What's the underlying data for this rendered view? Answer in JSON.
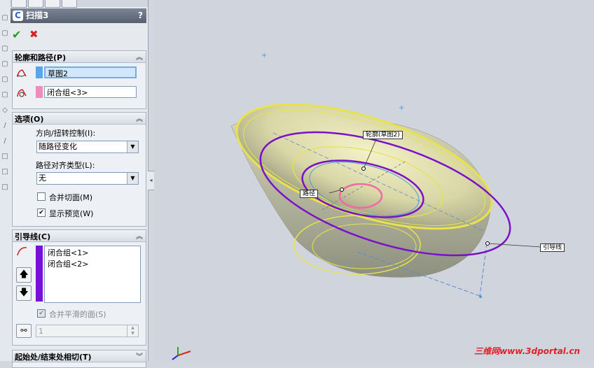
{
  "feature_panel": {
    "title": "扫描3",
    "help": "?",
    "icons": {
      "ok": "check-icon",
      "cancel": "x-icon"
    },
    "profile_path": {
      "header": "轮廓和路径(P)",
      "profile": {
        "value": "草图2",
        "color": "#5aa5e8",
        "icon": "profile-icon"
      },
      "path": {
        "value": "闭合组<3>",
        "color": "#f08cba",
        "icon": "path-icon"
      }
    },
    "options": {
      "header": "选项(O)",
      "orientation_label": "方向/扭转控制(I):",
      "orientation_value": "随路径变化",
      "alignment_label": "路径对齐类型(L):",
      "alignment_value": "无",
      "merge_tangent": {
        "label": "合并切面(M)",
        "checked": false
      },
      "show_preview": {
        "label": "显示预览(W)",
        "checked": true
      }
    },
    "guides": {
      "header": "引导线(C)",
      "color": "#7a10d8",
      "items": [
        "闭合组<1>",
        "闭合组<2>"
      ],
      "merge_smooth": {
        "label": "合并平滑的面(S)",
        "checked": true
      },
      "spin_value": "1"
    },
    "next_section": {
      "header": "起始处/结束处相切(T)"
    }
  },
  "viewport": {
    "callouts": {
      "profile": "轮廓(草图2)",
      "path": "路径",
      "guide": "引导线"
    },
    "watermark": "三维网www.3dportal.cn",
    "colors": {
      "yellow": "#e8e34a",
      "purple": "#7a10c8",
      "pink": "#f06aa6",
      "blue": "#4d9ad8"
    }
  }
}
